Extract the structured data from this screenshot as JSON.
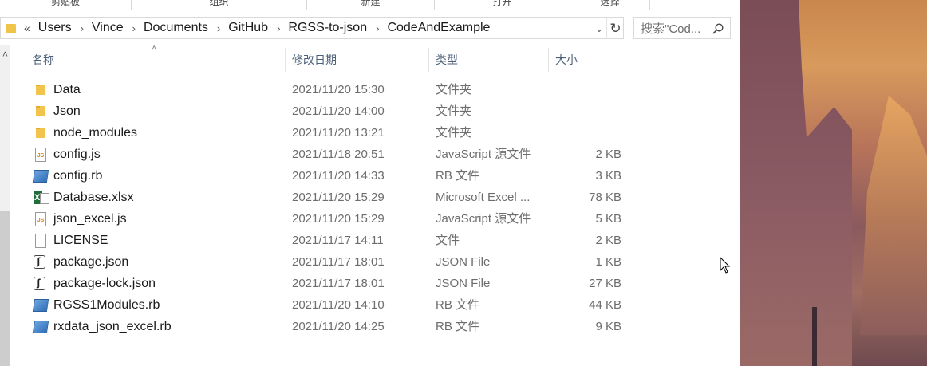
{
  "ribbon": {
    "groups": [
      "剪贴板",
      "组织",
      "新建",
      "打开",
      "选择"
    ]
  },
  "address": {
    "chevrons": "«",
    "crumbs": [
      "Users",
      "Vince",
      "Documents",
      "GitHub",
      "RGSS-to-json",
      "CodeAndExample"
    ],
    "dropdown_icon": "chevron-down-icon",
    "refresh_icon": "refresh-icon"
  },
  "search": {
    "placeholder": "搜索\"Cod..."
  },
  "columns": {
    "name": "名称",
    "date": "修改日期",
    "type": "类型",
    "size": "大小"
  },
  "files": [
    {
      "name": "Data",
      "date": "2021/11/20 15:30",
      "type": "文件夹",
      "size": "",
      "icon": "folder-icon"
    },
    {
      "name": "Json",
      "date": "2021/11/20 14:00",
      "type": "文件夹",
      "size": "",
      "icon": "folder-icon"
    },
    {
      "name": "node_modules",
      "date": "2021/11/20 13:21",
      "type": "文件夹",
      "size": "",
      "icon": "folder-icon"
    },
    {
      "name": "config.js",
      "date": "2021/11/18 20:51",
      "type": "JavaScript 源文件",
      "size": "2 KB",
      "icon": "js-file-icon"
    },
    {
      "name": "config.rb",
      "date": "2021/11/20 14:33",
      "type": "RB 文件",
      "size": "3 KB",
      "icon": "rb-file-icon"
    },
    {
      "name": "Database.xlsx",
      "date": "2021/11/20 15:29",
      "type": "Microsoft Excel ...",
      "size": "78 KB",
      "icon": "excel-file-icon"
    },
    {
      "name": "json_excel.js",
      "date": "2021/11/20 15:29",
      "type": "JavaScript 源文件",
      "size": "5 KB",
      "icon": "js-file-icon"
    },
    {
      "name": "LICENSE",
      "date": "2021/11/17 14:11",
      "type": "文件",
      "size": "2 KB",
      "icon": "file-icon"
    },
    {
      "name": "package.json",
      "date": "2021/11/17 18:01",
      "type": "JSON File",
      "size": "1 KB",
      "icon": "json-file-icon"
    },
    {
      "name": "package-lock.json",
      "date": "2021/11/17 18:01",
      "type": "JSON File",
      "size": "27 KB",
      "icon": "json-file-icon"
    },
    {
      "name": "RGSS1Modules.rb",
      "date": "2021/11/20 14:10",
      "type": "RB 文件",
      "size": "44 KB",
      "icon": "rb-file-icon"
    },
    {
      "name": "rxdata_json_excel.rb",
      "date": "2021/11/20 14:25",
      "type": "RB 文件",
      "size": "9 KB",
      "icon": "rb-file-icon"
    }
  ]
}
